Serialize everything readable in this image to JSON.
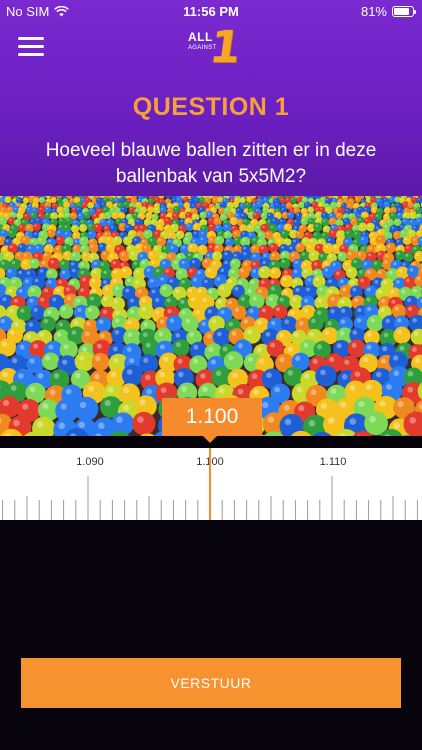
{
  "status_bar": {
    "carrier": "No SIM",
    "time": "11:56 PM",
    "battery": "81%",
    "battery_level": 0.81
  },
  "logo": {
    "line1": "ALL",
    "line2": "AGAINST",
    "numeral": "1"
  },
  "question": {
    "label": "QUESTION 1",
    "text": "Hoeveel blauwe ballen zitten er in deze ballenbak van 5x5M2?"
  },
  "image": {
    "subject": "ball-pit",
    "colors": [
      "#1f5fd6",
      "#e23a2c",
      "#f4c21c",
      "#2f9e3c",
      "#7ed957",
      "#f08a1f",
      "#2a7cf0",
      "#c9d82a"
    ]
  },
  "slider": {
    "value": "1.100",
    "ticks": [
      "1.090",
      "1.100",
      "1.110"
    ],
    "accent": "#f58b2c"
  },
  "submit": {
    "label": "VERSTUUR"
  },
  "colors": {
    "header_purple": "#6a1fc0",
    "accent_orange": "#f7932e",
    "background": "#07040d"
  }
}
